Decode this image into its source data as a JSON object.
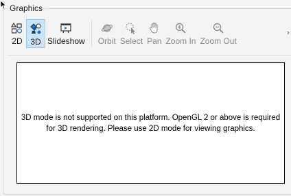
{
  "group": {
    "title": "Graphics"
  },
  "toolbar": {
    "items": [
      {
        "label": "2D",
        "icon": "2d-shapes-icon",
        "enabled": true,
        "active": false
      },
      {
        "label": "3D",
        "icon": "3d-shapes-icon",
        "enabled": true,
        "active": true
      },
      {
        "label": "Slideshow",
        "icon": "slideshow-icon",
        "enabled": true,
        "active": false
      },
      {
        "label": "Orbit",
        "icon": "orbit-icon",
        "enabled": false,
        "active": false
      },
      {
        "label": "Select",
        "icon": "select-pointer-icon",
        "enabled": false,
        "active": false
      },
      {
        "label": "Pan",
        "icon": "pan-hand-icon",
        "enabled": false,
        "active": false
      },
      {
        "label": "Zoom In",
        "icon": "zoom-in-icon",
        "enabled": false,
        "active": false
      },
      {
        "label": "Zoom Out",
        "icon": "zoom-out-icon",
        "enabled": false,
        "active": false
      }
    ],
    "more_glyph": "›"
  },
  "viewport": {
    "message": "3D mode is not supported on this platform. OpenGL 2 or above is required for 3D rendering. Please use 2D mode for viewing graphics."
  },
  "colors": {
    "active_bg": "#cce4f7",
    "active_border": "#99c9ef",
    "accent_blue": "#1e73be",
    "disabled_text": "#8a8a8a"
  }
}
